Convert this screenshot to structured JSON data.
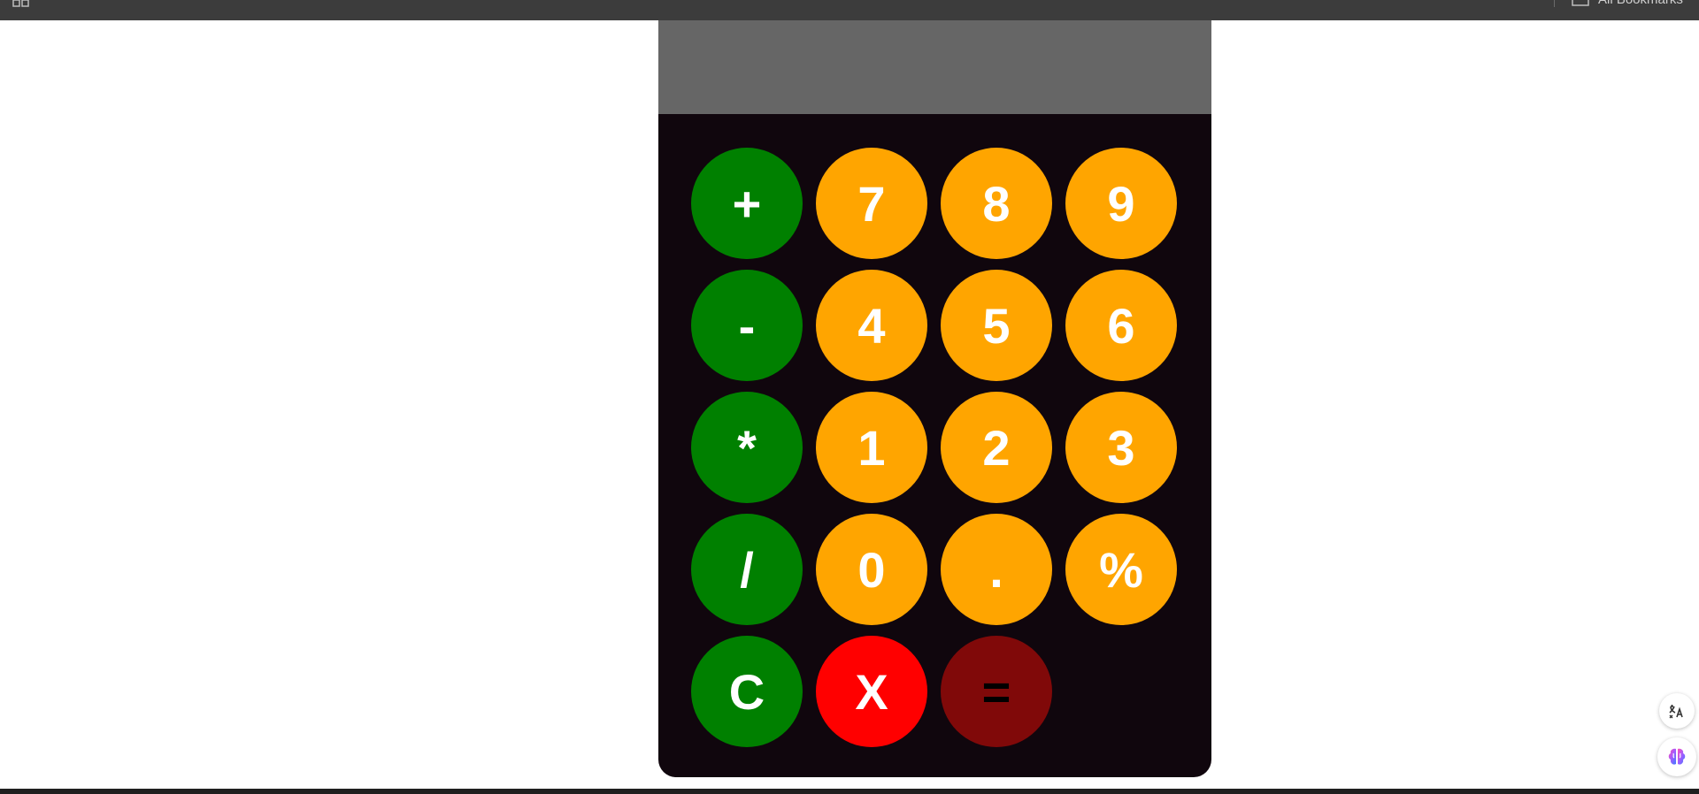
{
  "browser": {
    "bookmarks_label": "All Bookmarks",
    "icons": [
      "apps-icon",
      "bookmark-folder-icon"
    ]
  },
  "calculator": {
    "display_value": "",
    "colors": {
      "body": "#10060d",
      "display": "#666666",
      "operator": "#008000",
      "number": "#ffa500",
      "delete": "#ff0000",
      "equals": "#800909"
    },
    "keys": [
      {
        "label": "+",
        "type": "op",
        "name": "plus"
      },
      {
        "label": "7",
        "type": "num",
        "name": "7"
      },
      {
        "label": "8",
        "type": "num",
        "name": "8"
      },
      {
        "label": "9",
        "type": "num",
        "name": "9"
      },
      {
        "label": "-",
        "type": "op",
        "name": "minus"
      },
      {
        "label": "4",
        "type": "num",
        "name": "4"
      },
      {
        "label": "5",
        "type": "num",
        "name": "5"
      },
      {
        "label": "6",
        "type": "num",
        "name": "6"
      },
      {
        "label": "*",
        "type": "op",
        "name": "multiply"
      },
      {
        "label": "1",
        "type": "num",
        "name": "1"
      },
      {
        "label": "2",
        "type": "num",
        "name": "2"
      },
      {
        "label": "3",
        "type": "num",
        "name": "3"
      },
      {
        "label": "/",
        "type": "op",
        "name": "divide"
      },
      {
        "label": "0",
        "type": "num",
        "name": "0"
      },
      {
        "label": ".",
        "type": "num",
        "name": "decimal"
      },
      {
        "label": "%",
        "type": "num",
        "name": "percent"
      },
      {
        "label": "C",
        "type": "op",
        "name": "clear"
      },
      {
        "label": "X",
        "type": "del",
        "name": "delete"
      },
      {
        "label": "=",
        "type": "eq",
        "name": "equals"
      }
    ]
  },
  "floating_buttons": [
    {
      "name": "translate-icon"
    },
    {
      "name": "ai-brain-icon"
    }
  ]
}
